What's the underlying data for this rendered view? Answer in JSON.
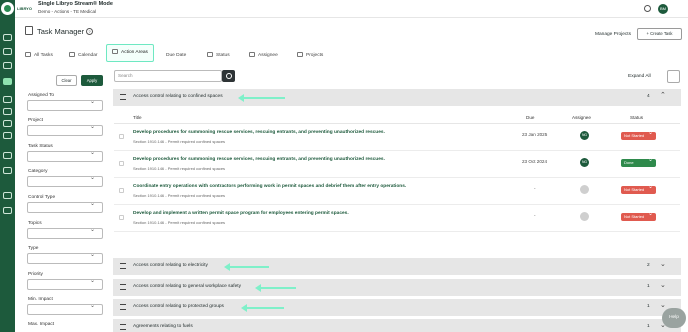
{
  "brand": {
    "name": "LIBRYO"
  },
  "header": {
    "title": "Single Libryo Stream® Mode",
    "subtitle": "Demo - Actions - TE Medical",
    "avatar": "BM"
  },
  "page": {
    "title": "Task Manager",
    "manage_projects": "Manage Projects",
    "create_task": "Create Task"
  },
  "tabs": [
    {
      "label": "All Tasks"
    },
    {
      "label": "Calendar"
    },
    {
      "label": "Action Areas"
    },
    {
      "label": "Due Date"
    },
    {
      "label": "Status"
    },
    {
      "label": "Assignee"
    },
    {
      "label": "Projects"
    }
  ],
  "filters": {
    "clear": "Clear",
    "apply": "Apply",
    "fields": [
      {
        "label": "Assigned To"
      },
      {
        "label": "Project"
      },
      {
        "label": "Task Status"
      },
      {
        "label": "Category"
      },
      {
        "label": "Control Type"
      },
      {
        "label": "Topics"
      },
      {
        "label": "Type"
      },
      {
        "label": "Priority"
      },
      {
        "label": "Min. Impact"
      },
      {
        "label": "Max. Impact"
      }
    ]
  },
  "search": {
    "placeholder": "Search"
  },
  "toolbar": {
    "expand_all": "Expand All"
  },
  "table": {
    "headers": {
      "title": "Title",
      "due": "Due",
      "assignee": "Assignee",
      "status": "Status"
    }
  },
  "groups": [
    {
      "name": "Access control relating to confined spaces",
      "count": "4"
    },
    {
      "name": "Access control relating to electricity",
      "count": "2"
    },
    {
      "name": "Access control relating to general workplace safety",
      "count": "1"
    },
    {
      "name": "Access control relating to protected groups",
      "count": "1"
    },
    {
      "name": "Agreements relating to fuels",
      "count": "1"
    }
  ],
  "rows": [
    {
      "title": "Develop procedures for summoning rescue services, rescuing entrants, and preventing unauthorized rescues.",
      "section": "Section 1910.146 - Permit required confined spaces",
      "due": "23 Jan 2025",
      "assignee": "NG",
      "status": "Not Started"
    },
    {
      "title": "Develop procedures for summoning rescue services, rescuing entrants, and preventing unauthorized rescues.",
      "section": "Section 1910.146 - Permit required confined spaces",
      "due": "23 Oct 2024",
      "assignee": "NG",
      "status": "Done"
    },
    {
      "title": "Coordinate entry operations with contractors performing work in permit spaces and debrief them after entry operations.",
      "section": "Section 1910.146 - Permit required confined spaces",
      "due": "-",
      "assignee": "",
      "status": "Not Started"
    },
    {
      "title": "Develop and implement a written permit space program for employees entering permit spaces.",
      "section": "Section 1910.146 - Permit required confined spaces",
      "due": "-",
      "assignee": "",
      "status": "Not Started"
    }
  ],
  "help": {
    "label": "Help"
  },
  "colors": {
    "brand": "#1d5a3c",
    "highlight": "#7ff0c9",
    "not_started": "#e05a4f",
    "done": "#2f8a4c"
  }
}
